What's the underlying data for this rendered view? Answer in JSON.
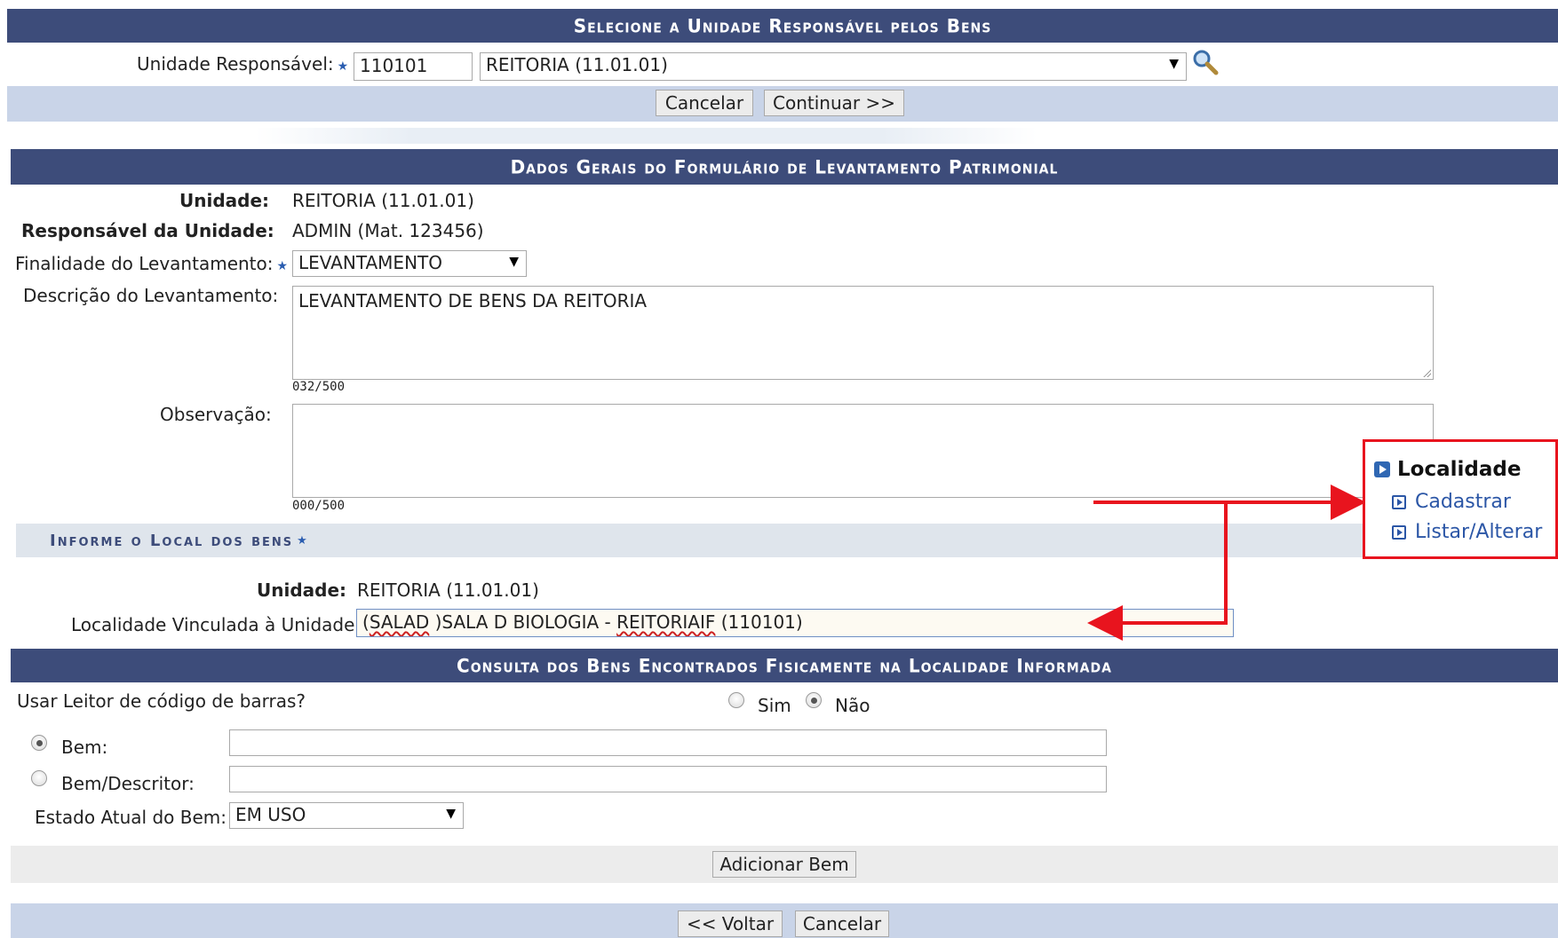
{
  "section1": {
    "title": "Selecione a Unidade Responsável pelos Bens",
    "unidade_label": "Unidade Responsável:",
    "unidade_code": "110101",
    "unidade_select": "REITORIA (11.01.01)",
    "cancel_button": "Cancelar",
    "continue_button": "Continuar >>"
  },
  "section2": {
    "title": "Dados Gerais do Formulário de Levantamento Patrimonial",
    "unidade_label": "Unidade:",
    "unidade_value": "REITORIA (11.01.01)",
    "responsavel_label": "Responsável da Unidade:",
    "responsavel_value": "ADMIN (Mat. 123456)",
    "finalidade_label": "Finalidade do Levantamento:",
    "finalidade_value": "LEVANTAMENTO",
    "descricao_label": "Descrição do Levantamento:",
    "descricao_value": "LEVANTAMENTO DE BENS DA REITORIA",
    "descricao_counter": "032/500",
    "observacao_label": "Observação:",
    "observacao_value": "",
    "observacao_counter": "000/500"
  },
  "local": {
    "title": "Informe o Local dos bens",
    "unidade_label": "Unidade:",
    "unidade_value": "REITORIA (11.01.01)",
    "localidade_label": "Localidade Vinculada à Unidade:",
    "localidade_value_a": "(",
    "localidade_value_b": "SALAD",
    "localidade_value_c": " )SALA D BIOLOGIA - ",
    "localidade_value_d": "REITORIAIF",
    "localidade_value_e": " (110101)"
  },
  "consulta": {
    "title": "Consulta dos Bens Encontrados Fisicamente na Localidade Informada",
    "leitor_label": "Usar Leitor de código de barras?",
    "sim_label": "Sim",
    "nao_label": "Não",
    "bem_label": "Bem:",
    "bem_descritor_label": "Bem/Descritor:",
    "estado_label": "Estado Atual do Bem:",
    "estado_value": "EM USO",
    "add_button": "Adicionar Bem"
  },
  "footer": {
    "back_button": "<< Voltar",
    "cancel_button": "Cancelar"
  },
  "popup": {
    "title": "Localidade",
    "link1": "Cadastrar",
    "link2": "Listar/Alterar"
  },
  "colors": {
    "bar": "#3d4c7a",
    "light_row": "#c9d4e8",
    "highlight": "#e8141e",
    "link": "#2b56a6"
  }
}
